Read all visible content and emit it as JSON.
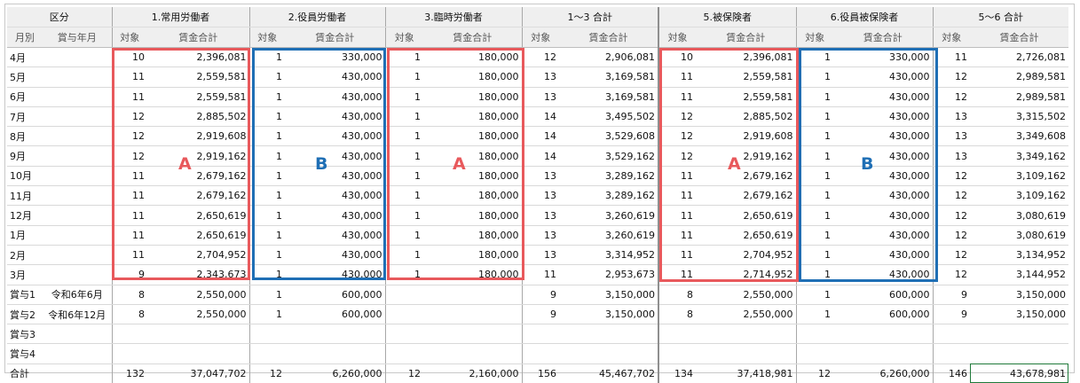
{
  "header": {
    "kubun": "区分",
    "col1": "1.常用労働者",
    "col2": "2.役員労働者",
    "col3": "3.臨時労働者",
    "col4": "1～3 合計",
    "col5": "5.被保険者",
    "col6": "6.役員被保険者",
    "col7": "5～6 合計",
    "monthly": "月別",
    "bonus_month": "賞与年月",
    "target": "対象",
    "wage_total": "賃金合計"
  },
  "rows": [
    {
      "label": "4月",
      "sub": "",
      "c": [
        "10",
        "2,396,081",
        "1",
        "330,000",
        "1",
        "180,000",
        "12",
        "2,906,081",
        "10",
        "2,396,081",
        "1",
        "330,000",
        "11",
        "2,726,081"
      ]
    },
    {
      "label": "5月",
      "sub": "",
      "c": [
        "11",
        "2,559,581",
        "1",
        "430,000",
        "1",
        "180,000",
        "13",
        "3,169,581",
        "11",
        "2,559,581",
        "1",
        "430,000",
        "12",
        "2,989,581"
      ]
    },
    {
      "label": "6月",
      "sub": "",
      "c": [
        "11",
        "2,559,581",
        "1",
        "430,000",
        "1",
        "180,000",
        "13",
        "3,169,581",
        "11",
        "2,559,581",
        "1",
        "430,000",
        "12",
        "2,989,581"
      ]
    },
    {
      "label": "7月",
      "sub": "",
      "c": [
        "12",
        "2,885,502",
        "1",
        "430,000",
        "1",
        "180,000",
        "14",
        "3,495,502",
        "12",
        "2,885,502",
        "1",
        "430,000",
        "13",
        "3,315,502"
      ]
    },
    {
      "label": "8月",
      "sub": "",
      "c": [
        "12",
        "2,919,608",
        "1",
        "430,000",
        "1",
        "180,000",
        "14",
        "3,529,608",
        "12",
        "2,919,608",
        "1",
        "430,000",
        "13",
        "3,349,608"
      ]
    },
    {
      "label": "9月",
      "sub": "",
      "c": [
        "12",
        "2,919,162",
        "1",
        "430,000",
        "1",
        "180,000",
        "14",
        "3,529,162",
        "12",
        "2,919,162",
        "1",
        "430,000",
        "13",
        "3,349,162"
      ]
    },
    {
      "label": "10月",
      "sub": "",
      "c": [
        "11",
        "2,679,162",
        "1",
        "430,000",
        "1",
        "180,000",
        "13",
        "3,289,162",
        "11",
        "2,679,162",
        "1",
        "430,000",
        "12",
        "3,109,162"
      ]
    },
    {
      "label": "11月",
      "sub": "",
      "c": [
        "11",
        "2,679,162",
        "1",
        "430,000",
        "1",
        "180,000",
        "13",
        "3,289,162",
        "11",
        "2,679,162",
        "1",
        "430,000",
        "12",
        "3,109,162"
      ]
    },
    {
      "label": "12月",
      "sub": "",
      "c": [
        "11",
        "2,650,619",
        "1",
        "430,000",
        "1",
        "180,000",
        "13",
        "3,260,619",
        "11",
        "2,650,619",
        "1",
        "430,000",
        "12",
        "3,080,619"
      ]
    },
    {
      "label": "1月",
      "sub": "",
      "c": [
        "11",
        "2,650,619",
        "1",
        "430,000",
        "1",
        "180,000",
        "13",
        "3,260,619",
        "11",
        "2,650,619",
        "1",
        "430,000",
        "12",
        "3,080,619"
      ]
    },
    {
      "label": "2月",
      "sub": "",
      "c": [
        "11",
        "2,704,952",
        "1",
        "430,000",
        "1",
        "180,000",
        "13",
        "3,314,952",
        "11",
        "2,704,952",
        "1",
        "430,000",
        "12",
        "3,134,952"
      ]
    },
    {
      "label": "3月",
      "sub": "",
      "c": [
        "9",
        "2,343,673",
        "1",
        "430,000",
        "1",
        "180,000",
        "11",
        "2,953,673",
        "11",
        "2,714,952",
        "1",
        "430,000",
        "12",
        "3,144,952"
      ]
    },
    {
      "label": "賞与1",
      "sub": "令和6年6月",
      "c": [
        "8",
        "2,550,000",
        "1",
        "600,000",
        "",
        "",
        "9",
        "3,150,000",
        "8",
        "2,550,000",
        "1",
        "600,000",
        "9",
        "3,150,000"
      ]
    },
    {
      "label": "賞与2",
      "sub": "令和6年12月",
      "c": [
        "8",
        "2,550,000",
        "1",
        "600,000",
        "",
        "",
        "9",
        "3,150,000",
        "8",
        "2,550,000",
        "1",
        "600,000",
        "9",
        "3,150,000"
      ]
    },
    {
      "label": "賞与3",
      "sub": "",
      "c": [
        "",
        "",
        "",
        "",
        "",
        "",
        "",
        "",
        "",
        "",
        "",
        "",
        "",
        ""
      ]
    },
    {
      "label": "賞与4",
      "sub": "",
      "c": [
        "",
        "",
        "",
        "",
        "",
        "",
        "",
        "",
        "",
        "",
        "",
        "",
        "",
        ""
      ]
    },
    {
      "label": "合計",
      "sub": "",
      "c": [
        "132",
        "37,047,702",
        "12",
        "6,260,000",
        "12",
        "2,160,000",
        "156",
        "45,467,702",
        "134",
        "37,418,981",
        "12",
        "6,260,000",
        "146",
        "43,678,981"
      ]
    }
  ],
  "annotations": {
    "a_label": "A",
    "b_label": "B",
    "red_color": "#e8595c",
    "blue_color": "#1f6fb5"
  }
}
